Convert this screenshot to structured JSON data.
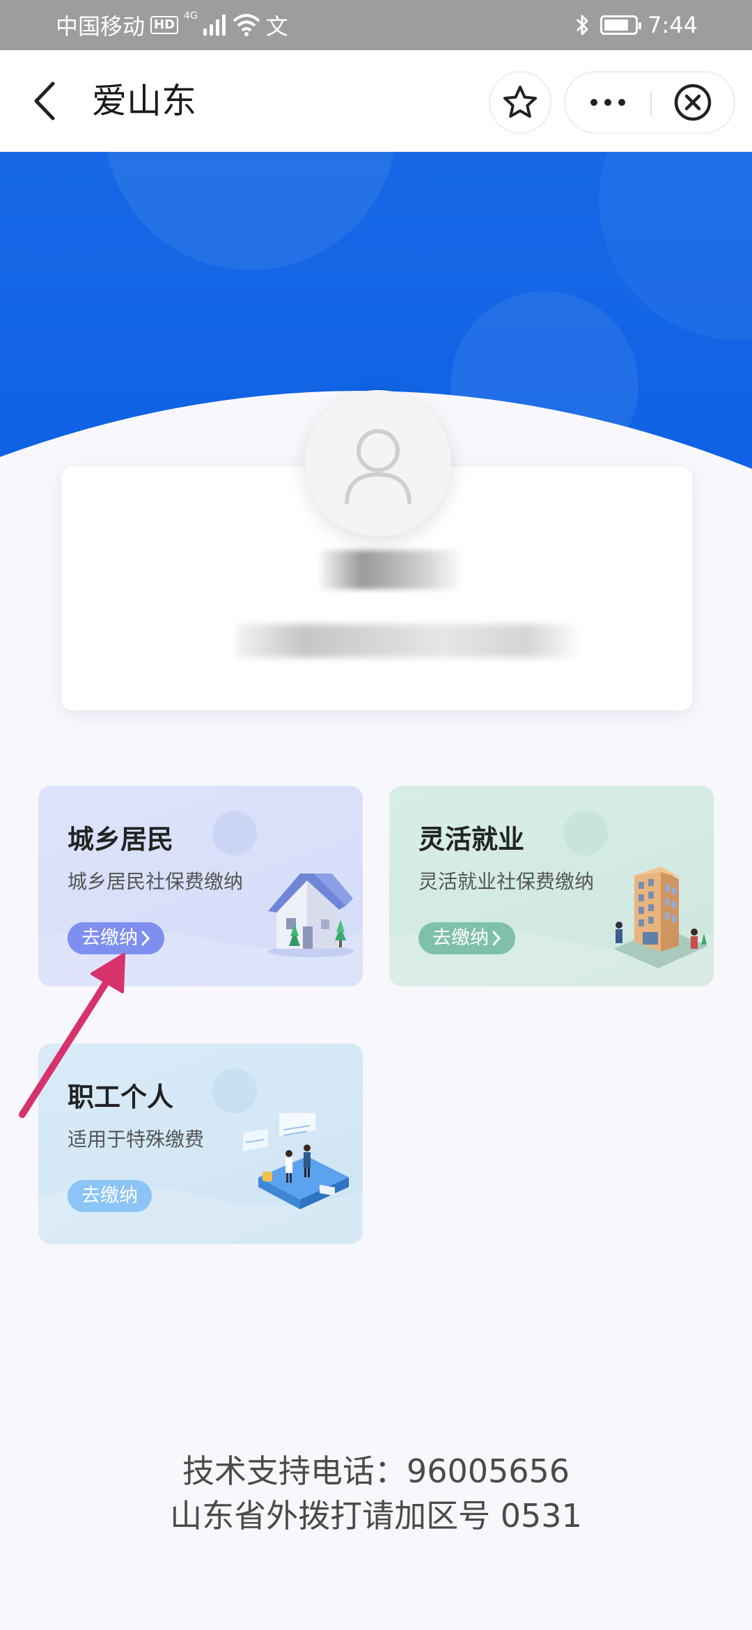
{
  "status_bar": {
    "carrier": "中国移动",
    "hd_badge": "HD",
    "network": "4G",
    "extra_icon": "文",
    "time": "7:44",
    "battery_level": 0.8
  },
  "nav": {
    "title": "爱山东",
    "back_icon": "chevron-left-icon",
    "favorite_icon": "star-icon",
    "more_icon": "more-dots-icon",
    "close_icon": "close-circle-icon"
  },
  "colors": {
    "header_blue": "#1a6be8",
    "residents_button": "#7f8ff0",
    "flexible_button": "#7fc1a8",
    "worker_button": "#8bc4f5",
    "arrow": "#d6336c"
  },
  "profile": {
    "avatar_icon": "user-avatar-icon"
  },
  "services": [
    {
      "title": "城乡居民",
      "subtitle": "城乡居民社保费缴纳",
      "button": "去缴纳",
      "illustration": "house-icon"
    },
    {
      "title": "灵活就业",
      "subtitle": "灵活就业社保费缴纳",
      "button": "去缴纳",
      "illustration": "office-building-icon"
    },
    {
      "title": "职工个人",
      "subtitle": "适用于特殊缴费",
      "button": "去缴纳",
      "illustration": "workers-platform-icon"
    }
  ],
  "footer": {
    "line1": "技术支持电话：96005656",
    "line2": "山东省外拨打请加区号 0531"
  }
}
